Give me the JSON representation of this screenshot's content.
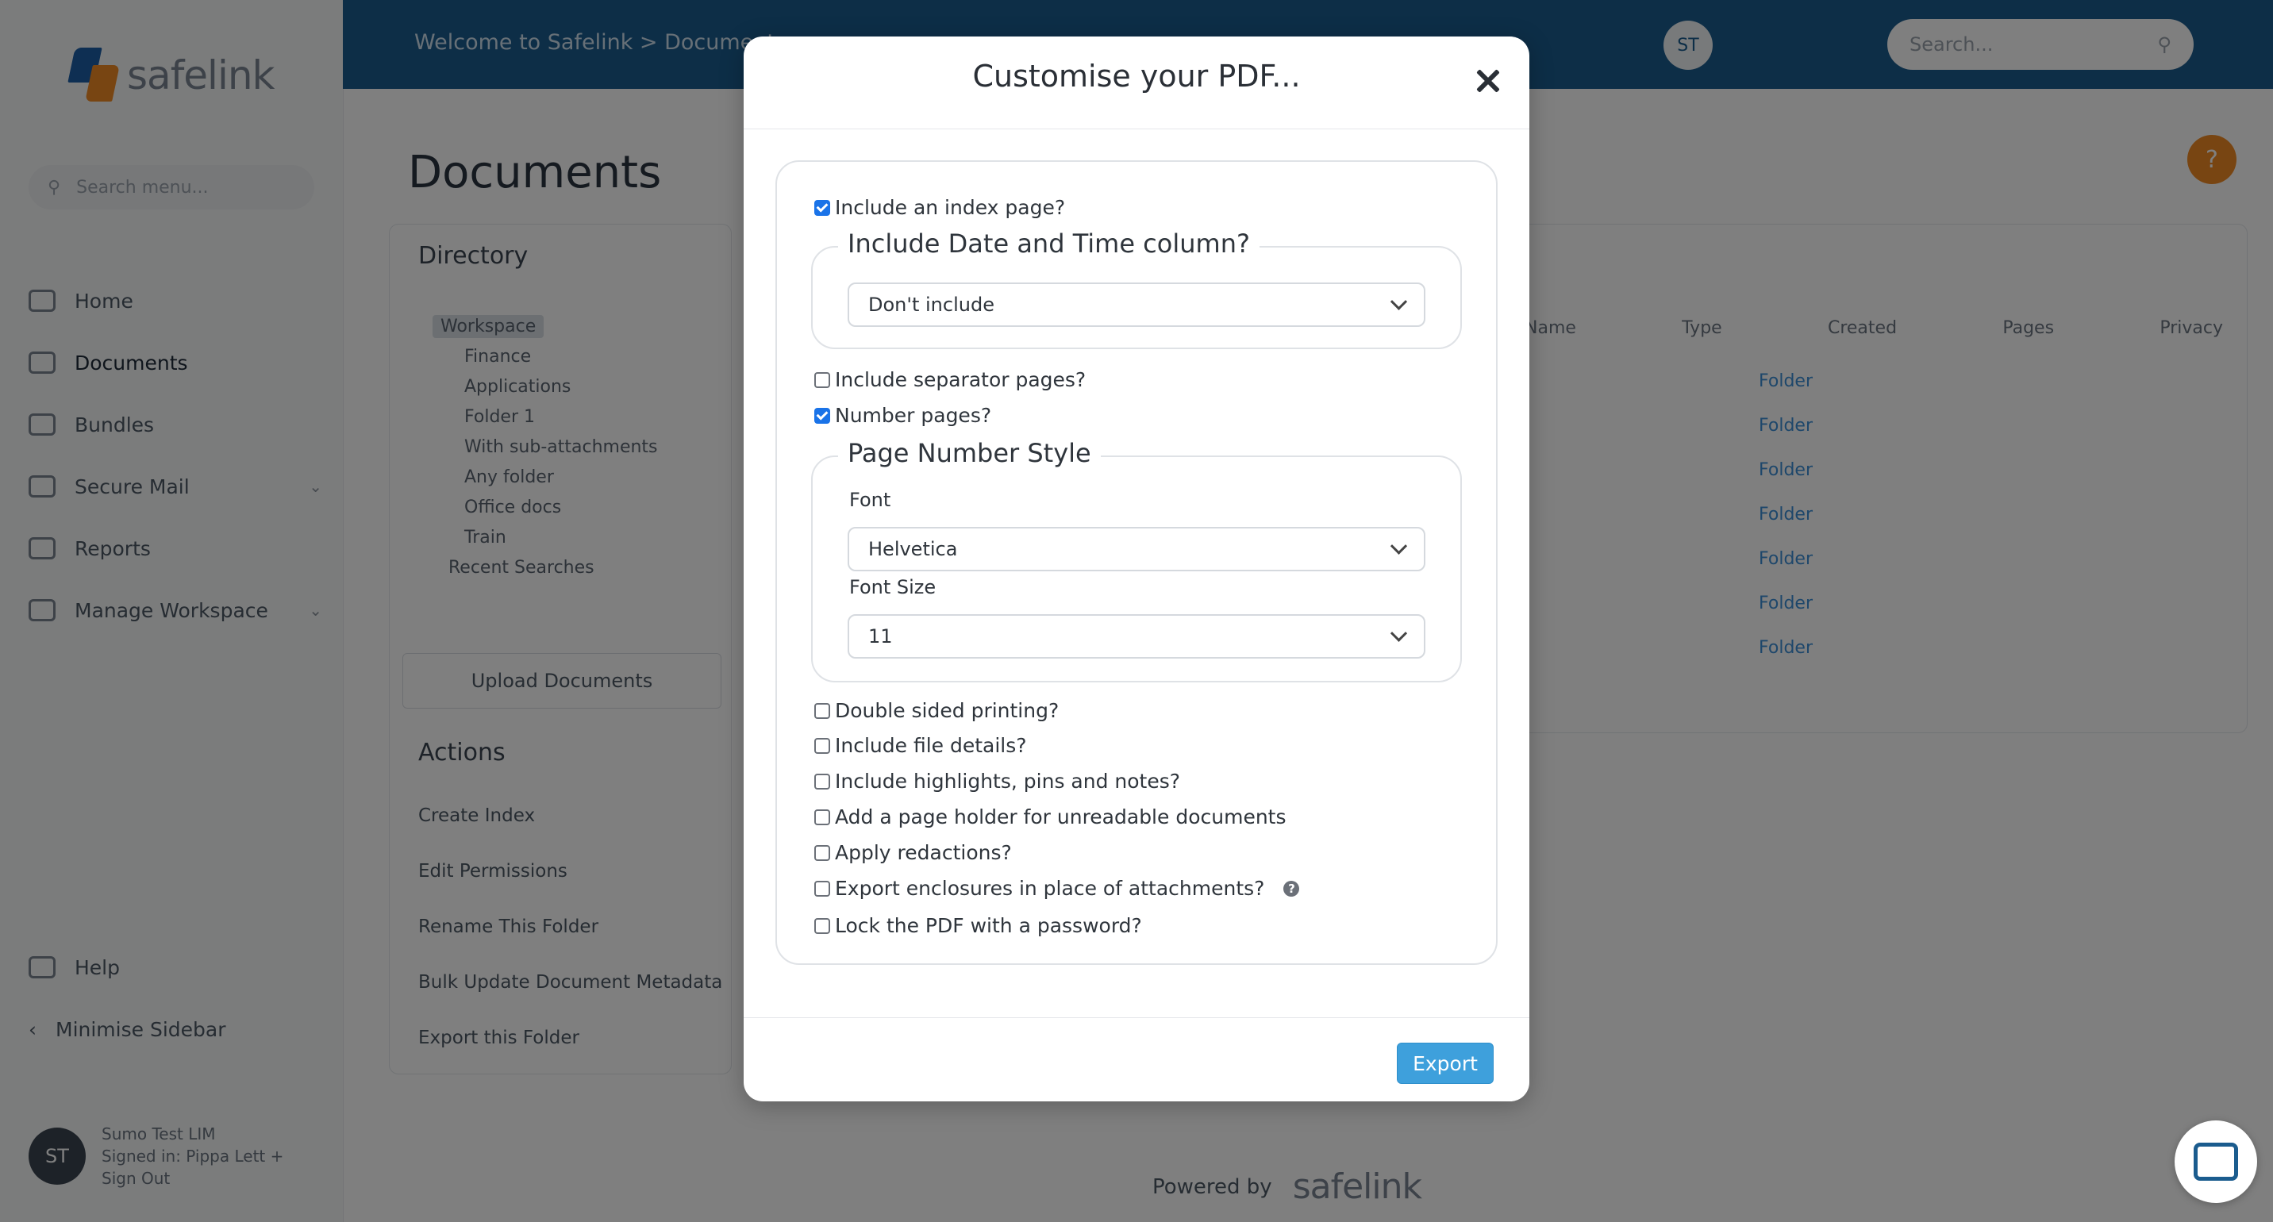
{
  "app": {
    "logo_text": "safelink",
    "menu_search_placeholder": "Search menu...",
    "nav": [
      {
        "label": "Home"
      },
      {
        "label": "Documents"
      },
      {
        "label": "Bundles"
      },
      {
        "label": "Secure Mail"
      },
      {
        "label": "Reports"
      },
      {
        "label": "Manage Workspace"
      }
    ],
    "nav_bottom": [
      {
        "label": "Help"
      },
      {
        "label": "Minimise Sidebar"
      }
    ],
    "user": {
      "initials": "ST",
      "name": "Sumo Test LIM",
      "sub1": "Signed in: Pippa Lett +",
      "sub2": "Sign Out"
    },
    "breadcrumb": "Welcome to Safelink  >  Documents",
    "topbar_avatar": "ST",
    "top_search_placeholder": "Search...",
    "page_title": "Documents",
    "directory_title": "Directory",
    "tree": [
      "Workspace",
      "Finance",
      "Applications",
      "Folder 1",
      "With sub-attachments",
      "Any folder",
      "Office docs",
      "Train",
      "Recent Searches"
    ],
    "upload_label": "Upload Documents",
    "actions_title": "Actions",
    "actions": [
      "Create Index",
      "Edit Permissions",
      "Rename This Folder",
      "Bulk Update Document Metadata",
      "Export this Folder"
    ],
    "table_headers": [
      "Name",
      "Type",
      "Created",
      "Pages",
      "Privacy"
    ],
    "table_type_value": "Folder",
    "powered_by": "Powered by",
    "powered_logo": "safelink"
  },
  "modal": {
    "title": "Customise your PDF...",
    "include_index": {
      "label": "Include an index page?",
      "checked": true
    },
    "date_time": {
      "legend": "Include Date and Time column?",
      "selected": "Don't include"
    },
    "separator_pages": {
      "label": "Include separator pages?",
      "checked": false
    },
    "number_pages": {
      "label": "Number pages?",
      "checked": true
    },
    "page_number_style": {
      "legend": "Page Number Style",
      "font_label": "Font",
      "font_value": "Helvetica",
      "size_label": "Font Size",
      "size_value": "11"
    },
    "options": [
      {
        "label": "Double sided printing?",
        "checked": false
      },
      {
        "label": "Include file details?",
        "checked": false
      },
      {
        "label": "Include highlights, pins and notes?",
        "checked": false
      },
      {
        "label": "Add a page holder for unreadable documents",
        "checked": false
      },
      {
        "label": "Apply redactions?",
        "checked": false
      },
      {
        "label": "Export enclosures in place of attachments?",
        "checked": false
      },
      {
        "label": "Lock the PDF with a password?",
        "checked": false
      }
    ],
    "help_glyph": "?",
    "export_label": "Export"
  }
}
